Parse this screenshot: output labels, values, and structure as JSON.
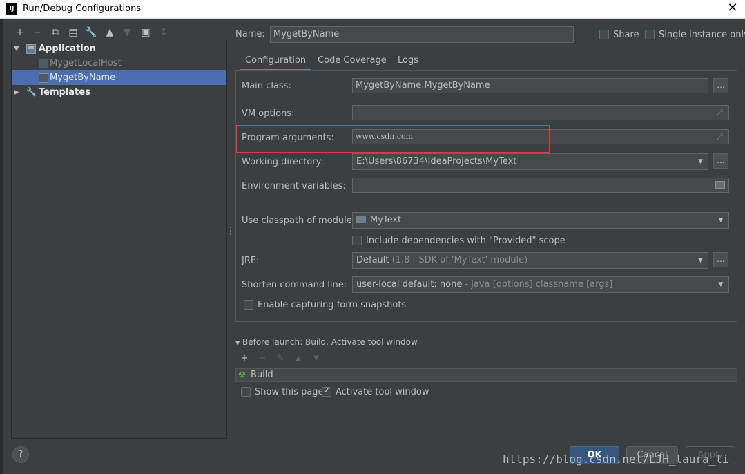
{
  "window": {
    "title": "Run/Debug Configurations",
    "app_icon": "IJ"
  },
  "toolbar": {
    "icons": [
      "plus-icon",
      "minus-icon",
      "copy-icon",
      "save-icon",
      "wrench-icon",
      "arrow-up-icon",
      "arrow-down-icon",
      "new-folder-icon",
      "sort-icon"
    ]
  },
  "tree": {
    "items": [
      {
        "label": "Application",
        "kind": "group",
        "expanded": true,
        "icon": "application-icon"
      },
      {
        "label": "MygetLocalHost",
        "kind": "config",
        "icon": "config-icon"
      },
      {
        "label": "MygetByName",
        "kind": "config",
        "selected": true,
        "icon": "config-icon"
      },
      {
        "label": "Templates",
        "kind": "group",
        "expanded": false,
        "icon": "wrench-icon"
      }
    ]
  },
  "header": {
    "name_label": "Name:",
    "name_value": "MygetByName",
    "share_label": "Share",
    "share_checked": false,
    "single_instance_label": "Single instance only",
    "single_instance_checked": false
  },
  "tabs": [
    {
      "label": "Configuration",
      "active": true
    },
    {
      "label": "Code Coverage",
      "active": false
    },
    {
      "label": "Logs",
      "active": false
    }
  ],
  "config": {
    "main_class_label": "Main class:",
    "main_class_value": "MygetByName.MygetByName",
    "vm_options_label": "VM options:",
    "vm_options_value": "",
    "program_args_label": "Program arguments:",
    "program_args_value": "www.csdn.com",
    "working_dir_label": "Working directory:",
    "working_dir_value": "E:\\Users\\86734\\IdeaProjects\\MyText",
    "env_vars_label": "Environment variables:",
    "env_vars_value": "",
    "classpath_label": "Use classpath of module:",
    "classpath_value": "MyText",
    "include_deps_label": "Include dependencies with \"Provided\" scope",
    "include_deps_checked": false,
    "jre_label": "JRE:",
    "jre_value": "Default",
    "jre_hint": "(1.8 - SDK of 'MyText' module)",
    "shorten_label": "Shorten command line:",
    "shorten_value": "user-local default: none",
    "shorten_hint": "- java [options] classname [args]",
    "capture_label": "Enable capturing form snapshots",
    "capture_checked": false,
    "browse_label": "..."
  },
  "before_launch": {
    "title": "Before launch: Build, Activate tool window",
    "task": "Build",
    "show_page_label": "Show this page",
    "show_page_checked": false,
    "activate_label": "Activate tool window",
    "activate_checked": true
  },
  "buttons": {
    "ok": "OK",
    "cancel": "Cancel",
    "apply": "Apply",
    "help": "?"
  },
  "watermark": "https://blog.csdn.net/LJH_laura_li",
  "colors": {
    "accent": "#4a88c7",
    "selection": "#4b6eaf",
    "highlight_box": "#e03c3c",
    "background": "#3c3f41"
  }
}
